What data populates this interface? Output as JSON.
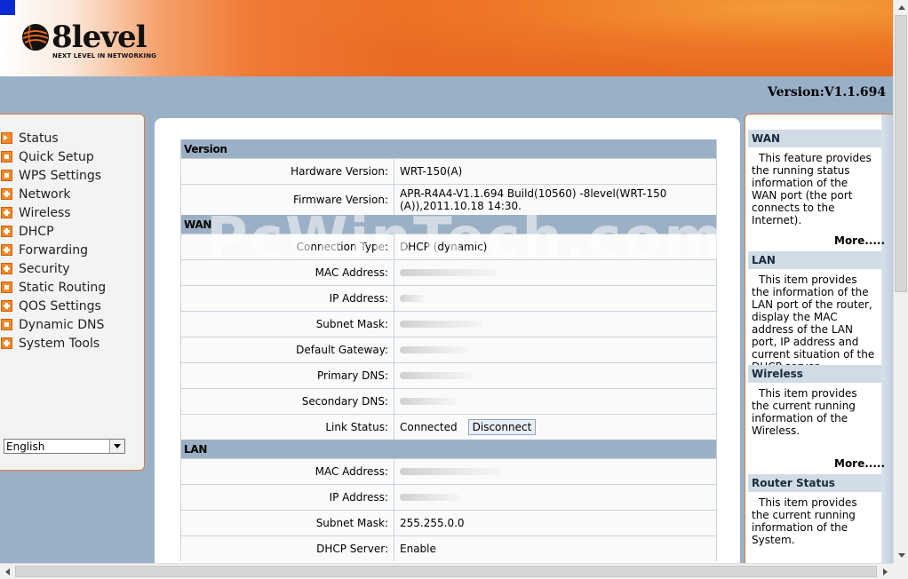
{
  "header": {
    "logo_text": "8level",
    "logo_tagline": "NEXT LEVEL IN NETWORKING",
    "version_label": "Version:V1.1.694",
    "brand_color": "#e8691f",
    "accent_blue": "#0a2bd4"
  },
  "sidebar": {
    "items": [
      {
        "label": "Status",
        "icon": "arrow-icon"
      },
      {
        "label": "Quick Setup",
        "icon": "square-icon"
      },
      {
        "label": "WPS Settings",
        "icon": "square-icon"
      },
      {
        "label": "Network",
        "icon": "plus-icon"
      },
      {
        "label": "Wireless",
        "icon": "plus-icon"
      },
      {
        "label": "DHCP",
        "icon": "plus-icon"
      },
      {
        "label": "Forwarding",
        "icon": "plus-icon"
      },
      {
        "label": "Security",
        "icon": "plus-icon"
      },
      {
        "label": "Static Routing",
        "icon": "square-icon"
      },
      {
        "label": "QOS Settings",
        "icon": "plus-icon"
      },
      {
        "label": "Dynamic DNS",
        "icon": "square-icon"
      },
      {
        "label": "System Tools",
        "icon": "plus-icon"
      }
    ],
    "language": {
      "selected": "English"
    }
  },
  "status": {
    "version_section": "Version",
    "hardware_version_label": "Hardware Version:",
    "hardware_version": "WRT-150(A)",
    "firmware_version_label": "Firmware Version:",
    "firmware_version_line1": "APR-R4A4-V1.1.694 Build(10560) -8level(WRT-150",
    "firmware_version_line2": "(A)),2011.10.18 14:30.",
    "wan_section": "WAN",
    "connection_type_label": "Connection Type:",
    "connection_type": "DHCP (dynamic)",
    "mac_label": "MAC Address:",
    "ip_label": "IP Address:",
    "subnet_label": "Subnet Mask:",
    "gateway_label": "Default Gateway:",
    "primary_dns_label": "Primary DNS:",
    "secondary_dns_label": "Secondary DNS:",
    "link_status_label": "Link Status:",
    "link_status": "Connected",
    "disconnect_button": "Disconnect",
    "lan_section": "LAN",
    "lan_mac_label": "MAC Address:",
    "lan_ip_label": "IP Address:",
    "lan_subnet_label": "Subnet Mask:",
    "lan_subnet": "255.255.0.0",
    "dhcp_server_label": "DHCP Server:",
    "dhcp_server": "Enable"
  },
  "help": {
    "wan_title": "WAN",
    "wan_text": "This feature provides the running status information of the WAN port (the port connects to the Internet).",
    "more1": "More.....",
    "lan_title": "LAN",
    "lan_text": "This item provides the information of the LAN port of the router, display the MAC address of the LAN port, IP address and current situation of the DHCP server.",
    "wireless_title": "Wireless",
    "wireless_text": "This item provides the current running information of the Wireless.",
    "more2": "More.....",
    "router_status_title": "Router Status",
    "router_status_text": "This item provides the current running information of the System."
  },
  "watermark": "PcWinTech.com"
}
